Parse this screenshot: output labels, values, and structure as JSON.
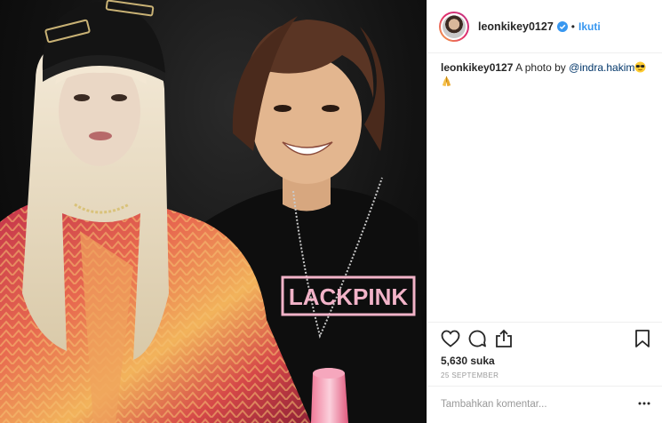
{
  "post": {
    "username": "leonkikey0127",
    "follow_label": "Ikuti",
    "separator": "•",
    "caption": {
      "user": "leonkikey0127",
      "text": "A photo by",
      "mention": "@indra.hakim",
      "emojis": [
        "sunglasses-emoji",
        "folded-hands-emoji"
      ]
    },
    "likes": "5,630 suka",
    "date": "25 SEPTEMBER",
    "comment": {
      "placeholder": "Tambahkan komentar...",
      "value": ""
    },
    "photo": {
      "shirt_text": "LACKPINK"
    }
  },
  "colors": {
    "link": "#3897f0",
    "mention": "#003569",
    "verified": "#3897f0",
    "divider": "#efefef",
    "muted": "#999999"
  },
  "icons": [
    "heart-icon",
    "comment-icon",
    "share-icon",
    "bookmark-icon",
    "more-options-icon",
    "verified-badge-icon"
  ]
}
